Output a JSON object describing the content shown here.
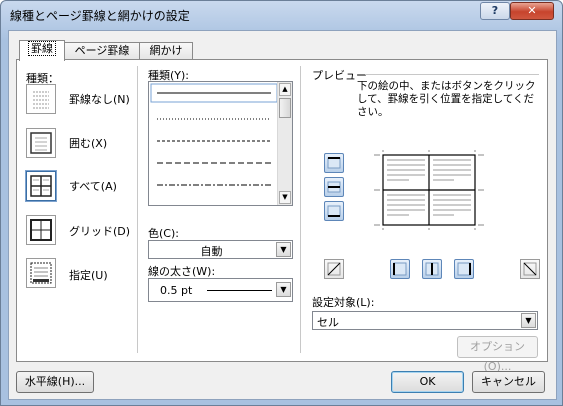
{
  "window": {
    "title": "線種とページ罫線と網かけの設定",
    "help_label": "?",
    "close_label": "✕"
  },
  "tabs": [
    {
      "label": "罫線"
    },
    {
      "label": "ページ罫線"
    },
    {
      "label": "網かけ"
    }
  ],
  "type_section": {
    "heading": "種類：",
    "options": [
      {
        "label": "罫線なし(N)",
        "icon": "no-border-icon",
        "selected": false
      },
      {
        "label": "囲む(X)",
        "icon": "box-border-icon",
        "selected": false
      },
      {
        "label": "すべて(A)",
        "icon": "all-borders-icon",
        "selected": true
      },
      {
        "label": "グリッド(D)",
        "icon": "grid-border-icon",
        "selected": false
      },
      {
        "label": "指定(U)",
        "icon": "custom-border-icon",
        "selected": false
      }
    ]
  },
  "style_section": {
    "line_type_label": "種類(Y):",
    "color_label": "色(C):",
    "color_value": "自動",
    "width_label": "線の太さ(W):",
    "width_value": "0.5 pt"
  },
  "preview_section": {
    "heading": "プレビュー",
    "instruction": "下の絵の中、またはボタンをクリックして、罫線を引く位置を指定してください。",
    "apply_to_label": "設定対象(L):",
    "apply_to_value": "セル",
    "options_button": "オプション(O)..."
  },
  "footer": {
    "horizontal_line_button": "水平線(H)...",
    "ok_button": "OK",
    "cancel_button": "キャンセル"
  },
  "colors": {
    "accent": "#3a6ea5",
    "titlebar": "#b9cfea",
    "close": "#c7442d"
  }
}
